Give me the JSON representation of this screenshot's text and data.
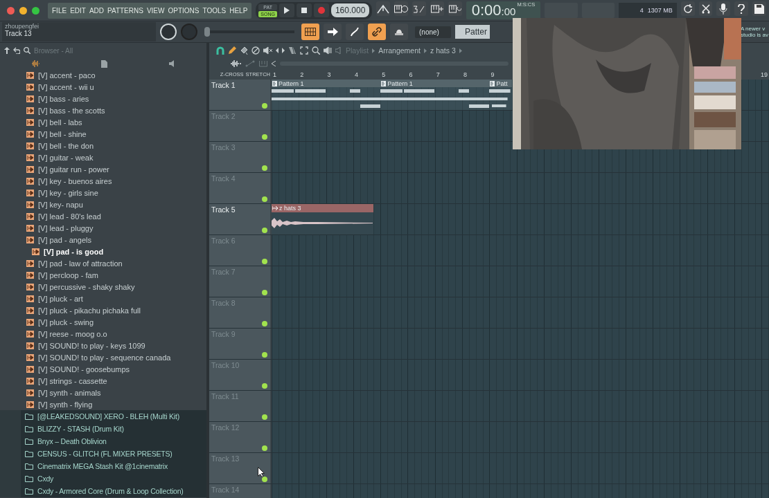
{
  "menu": [
    "FILE",
    "EDIT",
    "ADD",
    "PATTERNS",
    "VIEW",
    "OPTIONS",
    "TOOLS",
    "HELP"
  ],
  "transport": {
    "modes": [
      {
        "label": "PAT",
        "selected": false
      },
      {
        "label": "SONG",
        "selected": true
      }
    ],
    "tempo": "160.000"
  },
  "time": {
    "main": "0:00",
    "small": ":00",
    "unit": "M:S:CS"
  },
  "cpu": {
    "value": "4",
    "memory": "1307 MB"
  },
  "hint": {
    "title": "zhoupengfei",
    "text": "Track 13"
  },
  "pitch_slider": {
    "level": 0
  },
  "toggles": [
    {
      "kind": "grid",
      "selected": true
    },
    {
      "kind": "arrow",
      "selected": false
    },
    {
      "kind": "curve",
      "selected": false
    },
    {
      "kind": "link",
      "selected": true
    },
    {
      "kind": "dome",
      "selected": false
    }
  ],
  "pattern_selector": "(none)",
  "pattern_field": "Patter",
  "notice": [
    "A newer v",
    "studio is av"
  ],
  "browser": {
    "title": "Browser - All",
    "items": [
      {
        "kind": "instrument",
        "label": "[V] accent - paco",
        "selected": false
      },
      {
        "kind": "instrument",
        "label": "[V] accent - wii u",
        "selected": false
      },
      {
        "kind": "instrument",
        "label": "[V] bass - aries",
        "selected": false
      },
      {
        "kind": "instrument",
        "label": "[V] bass - the scotts",
        "selected": false
      },
      {
        "kind": "instrument",
        "label": "[V] bell - labs",
        "selected": false
      },
      {
        "kind": "instrument",
        "label": "[V] bell - shine",
        "selected": false
      },
      {
        "kind": "instrument",
        "label": "[V] bell - the don",
        "selected": false
      },
      {
        "kind": "instrument",
        "label": "[V] guitar - weak",
        "selected": false
      },
      {
        "kind": "instrument",
        "label": "[V] guitar run - power",
        "selected": false
      },
      {
        "kind": "instrument",
        "label": "[V] key - buenos aires",
        "selected": false
      },
      {
        "kind": "instrument",
        "label": "[V] key - girls sine",
        "selected": false
      },
      {
        "kind": "instrument",
        "label": "[V] key- napu",
        "selected": false
      },
      {
        "kind": "instrument",
        "label": "[V] lead - 80's lead",
        "selected": false
      },
      {
        "kind": "instrument",
        "label": "[V] lead - pluggy",
        "selected": false
      },
      {
        "kind": "instrument",
        "label": "[V] pad - angels",
        "selected": false
      },
      {
        "kind": "instrument",
        "label": "[V] pad - is good",
        "selected": true
      },
      {
        "kind": "instrument",
        "label": "[V] pad - law of attraction",
        "selected": false
      },
      {
        "kind": "instrument",
        "label": "[V] percloop - fam",
        "selected": false
      },
      {
        "kind": "instrument",
        "label": "[V] percussive - shaky shaky",
        "selected": false
      },
      {
        "kind": "instrument",
        "label": "[V] pluck - art",
        "selected": false
      },
      {
        "kind": "instrument",
        "label": "[V] pluck - pikachu pichaka full",
        "selected": false
      },
      {
        "kind": "instrument",
        "label": "[V] pluck - swing",
        "selected": false
      },
      {
        "kind": "instrument",
        "label": "[V] reese - moog o.o",
        "selected": false
      },
      {
        "kind": "instrument",
        "label": "[V] SOUND!  to play - keys 1099",
        "selected": false
      },
      {
        "kind": "instrument",
        "label": "[V] SOUND!  to play - sequence canada",
        "selected": false
      },
      {
        "kind": "instrument",
        "label": "[V] SOUND! - goosebumps",
        "selected": false
      },
      {
        "kind": "instrument",
        "label": "[V] strings - cassette",
        "selected": false
      },
      {
        "kind": "instrument",
        "label": "[V] synth - animals",
        "selected": false
      },
      {
        "kind": "instrument",
        "label": "[V] synth - flying",
        "selected": false
      },
      {
        "kind": "folder",
        "label": "[@LEAKEDSOUND] XERO - BLEH (Multi Kit)",
        "selected": false
      },
      {
        "kind": "folder",
        "label": "BLIZZY - STASH (Drum Kit)",
        "selected": false
      },
      {
        "kind": "folder",
        "label": "Bnyx – Death Oblivion",
        "selected": false
      },
      {
        "kind": "folder",
        "label": "CENSUS - GLITCH (FL MIXER PRESETS)",
        "selected": false
      },
      {
        "kind": "folder",
        "label": "Cinematrix MEGA Stash Kit @1cinematrix",
        "selected": false
      },
      {
        "kind": "folder",
        "label": "Cxdy",
        "selected": false
      },
      {
        "kind": "folder",
        "label": "Cxdy - Armored Core (Drum & Loop Collection)",
        "selected": false
      }
    ]
  },
  "playlist": {
    "breadcrumb": [
      "Playlist",
      "Arrangement",
      "z hats 3"
    ],
    "z_cross": "Z-CROSS",
    "stretch": "STRETCH",
    "ruler": [
      "1",
      "2",
      "3",
      "4",
      "5",
      "6",
      "7",
      "8",
      "9"
    ],
    "ruler_far": "19",
    "tracks": [
      {
        "name": "Track 1",
        "active": true,
        "enabled": true,
        "clips": [
          {
            "kind": "pattern",
            "label": "Pattern 1"
          },
          {
            "kind": "pattern",
            "label": "Pattern 1"
          },
          {
            "kind": "pattern",
            "label": "Patt"
          }
        ]
      },
      {
        "name": "Track 2",
        "active": false,
        "enabled": true
      },
      {
        "name": "Track 3",
        "active": false,
        "enabled": true
      },
      {
        "name": "Track 4",
        "active": false,
        "enabled": true
      },
      {
        "name": "Track 5",
        "active": true,
        "enabled": true,
        "clips": [
          {
            "kind": "audio",
            "label": "z hats 3"
          }
        ]
      },
      {
        "name": "Track 6",
        "active": false,
        "enabled": true
      },
      {
        "name": "Track 7",
        "active": false,
        "enabled": true
      },
      {
        "name": "Track 8",
        "active": false,
        "enabled": true
      },
      {
        "name": "Track 9",
        "active": false,
        "enabled": true
      },
      {
        "name": "Track 10",
        "active": false,
        "enabled": true
      },
      {
        "name": "Track 11",
        "active": false,
        "enabled": true
      },
      {
        "name": "Track 12",
        "active": false,
        "enabled": true
      },
      {
        "name": "Track 13",
        "active": false,
        "enabled": true
      },
      {
        "name": "Track 14",
        "active": false
      }
    ]
  }
}
